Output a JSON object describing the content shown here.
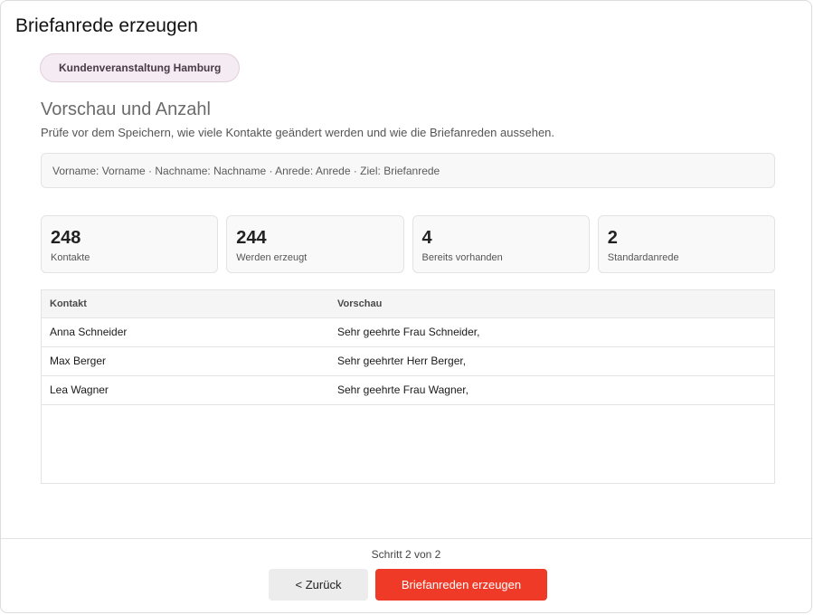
{
  "dialog": {
    "title": "Briefanrede erzeugen"
  },
  "chip": {
    "label": "Kundenveranstaltung Hamburg"
  },
  "section": {
    "title": "Vorschau und Anzahl",
    "description": "Prüfe vor dem Speichern, wie viele Kontakte geändert werden und wie die Briefanreden aussehen."
  },
  "mapping": {
    "text": "Vorname: Vorname · Nachname: Nachname · Anrede: Anrede · Ziel: Briefanrede"
  },
  "stats": [
    {
      "value": "248",
      "label": "Kontakte"
    },
    {
      "value": "244",
      "label": "Werden erzeugt"
    },
    {
      "value": "4",
      "label": "Bereits vorhanden"
    },
    {
      "value": "2",
      "label": "Standardanrede"
    }
  ],
  "table": {
    "headers": {
      "contact": "Kontakt",
      "preview": "Vorschau"
    },
    "rows": [
      {
        "contact": "Anna Schneider",
        "preview": "Sehr geehrte Frau Schneider,"
      },
      {
        "contact": "Max Berger",
        "preview": "Sehr geehrter Herr Berger,"
      },
      {
        "contact": "Lea Wagner",
        "preview": "Sehr geehrte Frau Wagner,"
      }
    ]
  },
  "footer": {
    "step": "Schritt 2 von 2",
    "back_label": "< Zurück",
    "primary_label": "Briefanreden erzeugen"
  },
  "colors": {
    "primary": "#ee3a27",
    "chip_bg": "#f4ecf2"
  }
}
